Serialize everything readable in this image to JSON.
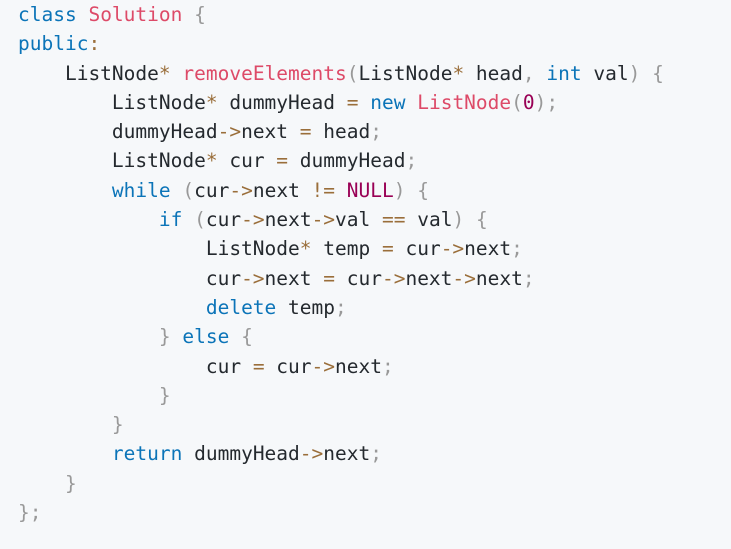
{
  "colors": {
    "background": "#f6f8fa",
    "keyword": "#0b74b8",
    "function": "#dd4a68",
    "operator": "#9a6e3a",
    "punctuation": "#999999",
    "number": "#990055",
    "text": "#24292e"
  },
  "code": {
    "language": "cpp",
    "lines": [
      [
        {
          "t": "kw",
          "v": "class"
        },
        {
          "t": "tx",
          "v": " "
        },
        {
          "t": "fn",
          "v": "Solution"
        },
        {
          "t": "tx",
          "v": " "
        },
        {
          "t": "pn",
          "v": "{"
        }
      ],
      [
        {
          "t": "kw",
          "v": "public"
        },
        {
          "t": "op",
          "v": ":"
        }
      ],
      [
        {
          "t": "tx",
          "v": "    ListNode"
        },
        {
          "t": "op",
          "v": "*"
        },
        {
          "t": "tx",
          "v": " "
        },
        {
          "t": "fn",
          "v": "removeElements"
        },
        {
          "t": "pn",
          "v": "("
        },
        {
          "t": "tx",
          "v": "ListNode"
        },
        {
          "t": "op",
          "v": "*"
        },
        {
          "t": "tx",
          "v": " head"
        },
        {
          "t": "pn",
          "v": ","
        },
        {
          "t": "tx",
          "v": " "
        },
        {
          "t": "kw",
          "v": "int"
        },
        {
          "t": "tx",
          "v": " val"
        },
        {
          "t": "pn",
          "v": ")"
        },
        {
          "t": "tx",
          "v": " "
        },
        {
          "t": "pn",
          "v": "{"
        }
      ],
      [
        {
          "t": "tx",
          "v": "        ListNode"
        },
        {
          "t": "op",
          "v": "*"
        },
        {
          "t": "tx",
          "v": " dummyHead "
        },
        {
          "t": "op",
          "v": "="
        },
        {
          "t": "tx",
          "v": " "
        },
        {
          "t": "kw",
          "v": "new"
        },
        {
          "t": "tx",
          "v": " "
        },
        {
          "t": "fn",
          "v": "ListNode"
        },
        {
          "t": "pn",
          "v": "("
        },
        {
          "t": "nm",
          "v": "0"
        },
        {
          "t": "pn",
          "v": ")"
        },
        {
          "t": "pn",
          "v": ";"
        }
      ],
      [
        {
          "t": "tx",
          "v": "        dummyHead"
        },
        {
          "t": "op",
          "v": "->"
        },
        {
          "t": "tx",
          "v": "next "
        },
        {
          "t": "op",
          "v": "="
        },
        {
          "t": "tx",
          "v": " head"
        },
        {
          "t": "pn",
          "v": ";"
        }
      ],
      [
        {
          "t": "tx",
          "v": "        ListNode"
        },
        {
          "t": "op",
          "v": "*"
        },
        {
          "t": "tx",
          "v": " cur "
        },
        {
          "t": "op",
          "v": "="
        },
        {
          "t": "tx",
          "v": " dummyHead"
        },
        {
          "t": "pn",
          "v": ";"
        }
      ],
      [
        {
          "t": "tx",
          "v": "        "
        },
        {
          "t": "kw",
          "v": "while"
        },
        {
          "t": "tx",
          "v": " "
        },
        {
          "t": "pn",
          "v": "("
        },
        {
          "t": "tx",
          "v": "cur"
        },
        {
          "t": "op",
          "v": "->"
        },
        {
          "t": "tx",
          "v": "next "
        },
        {
          "t": "op",
          "v": "!="
        },
        {
          "t": "tx",
          "v": " "
        },
        {
          "t": "nm",
          "v": "NULL"
        },
        {
          "t": "pn",
          "v": ")"
        },
        {
          "t": "tx",
          "v": " "
        },
        {
          "t": "pn",
          "v": "{"
        }
      ],
      [
        {
          "t": "tx",
          "v": "            "
        },
        {
          "t": "kw",
          "v": "if"
        },
        {
          "t": "tx",
          "v": " "
        },
        {
          "t": "pn",
          "v": "("
        },
        {
          "t": "tx",
          "v": "cur"
        },
        {
          "t": "op",
          "v": "->"
        },
        {
          "t": "tx",
          "v": "next"
        },
        {
          "t": "op",
          "v": "->"
        },
        {
          "t": "tx",
          "v": "val "
        },
        {
          "t": "op",
          "v": "=="
        },
        {
          "t": "tx",
          "v": " val"
        },
        {
          "t": "pn",
          "v": ")"
        },
        {
          "t": "tx",
          "v": " "
        },
        {
          "t": "pn",
          "v": "{"
        }
      ],
      [
        {
          "t": "tx",
          "v": "                ListNode"
        },
        {
          "t": "op",
          "v": "*"
        },
        {
          "t": "tx",
          "v": " temp "
        },
        {
          "t": "op",
          "v": "="
        },
        {
          "t": "tx",
          "v": " cur"
        },
        {
          "t": "op",
          "v": "->"
        },
        {
          "t": "tx",
          "v": "next"
        },
        {
          "t": "pn",
          "v": ";"
        }
      ],
      [
        {
          "t": "tx",
          "v": "                cur"
        },
        {
          "t": "op",
          "v": "->"
        },
        {
          "t": "tx",
          "v": "next "
        },
        {
          "t": "op",
          "v": "="
        },
        {
          "t": "tx",
          "v": " cur"
        },
        {
          "t": "op",
          "v": "->"
        },
        {
          "t": "tx",
          "v": "next"
        },
        {
          "t": "op",
          "v": "->"
        },
        {
          "t": "tx",
          "v": "next"
        },
        {
          "t": "pn",
          "v": ";"
        }
      ],
      [
        {
          "t": "tx",
          "v": "                "
        },
        {
          "t": "kw",
          "v": "delete"
        },
        {
          "t": "tx",
          "v": " temp"
        },
        {
          "t": "pn",
          "v": ";"
        }
      ],
      [
        {
          "t": "tx",
          "v": "            "
        },
        {
          "t": "pn",
          "v": "}"
        },
        {
          "t": "tx",
          "v": " "
        },
        {
          "t": "kw",
          "v": "else"
        },
        {
          "t": "tx",
          "v": " "
        },
        {
          "t": "pn",
          "v": "{"
        }
      ],
      [
        {
          "t": "tx",
          "v": "                cur "
        },
        {
          "t": "op",
          "v": "="
        },
        {
          "t": "tx",
          "v": " cur"
        },
        {
          "t": "op",
          "v": "->"
        },
        {
          "t": "tx",
          "v": "next"
        },
        {
          "t": "pn",
          "v": ";"
        }
      ],
      [
        {
          "t": "tx",
          "v": "            "
        },
        {
          "t": "pn",
          "v": "}"
        }
      ],
      [
        {
          "t": "tx",
          "v": "        "
        },
        {
          "t": "pn",
          "v": "}"
        }
      ],
      [
        {
          "t": "tx",
          "v": "        "
        },
        {
          "t": "kw",
          "v": "return"
        },
        {
          "t": "tx",
          "v": " dummyHead"
        },
        {
          "t": "op",
          "v": "->"
        },
        {
          "t": "tx",
          "v": "next"
        },
        {
          "t": "pn",
          "v": ";"
        }
      ],
      [
        {
          "t": "tx",
          "v": "    "
        },
        {
          "t": "pn",
          "v": "}"
        }
      ],
      [
        {
          "t": "pn",
          "v": "}"
        },
        {
          "t": "pn",
          "v": ";"
        }
      ]
    ]
  }
}
